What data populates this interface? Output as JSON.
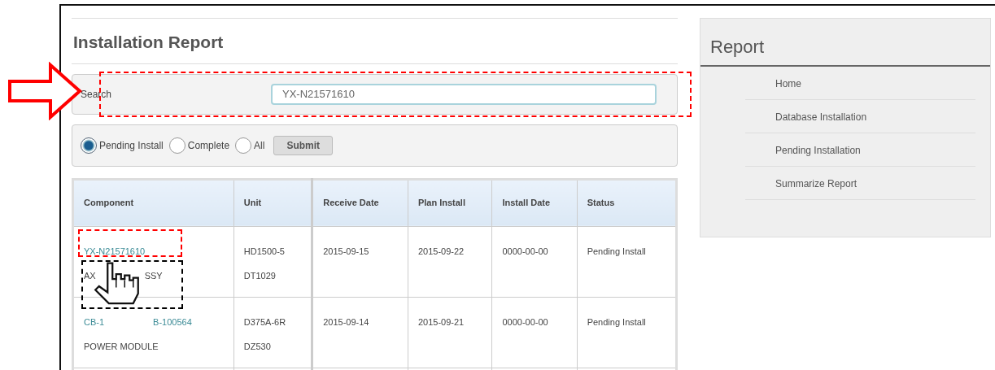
{
  "page": {
    "title": "Installation Report"
  },
  "search": {
    "label": "Search",
    "value": "YX-N21571610"
  },
  "filter": {
    "options": [
      {
        "label": "Pending Install",
        "selected": true
      },
      {
        "label": "Complete",
        "selected": false
      },
      {
        "label": "All",
        "selected": false
      }
    ],
    "submit": "Submit"
  },
  "table": {
    "columns": [
      "Component",
      "Unit",
      "Receive Date",
      "Plan Install",
      "Install Date",
      "Status"
    ],
    "rows": [
      {
        "component": [
          [
            "YX-N21571610"
          ],
          [
            "AX",
            "SSY"
          ]
        ],
        "unit": [
          "HD1500-5",
          "DT1029"
        ],
        "receive_date": "2015-09-15",
        "plan_install": "2015-09-22",
        "install_date": "0000-00-00",
        "status": "Pending Install"
      },
      {
        "component": [
          [
            "CB-1",
            "B-100564"
          ],
          [
            "POWER MODULE"
          ]
        ],
        "unit": [
          "D375A-6R",
          "DZ530"
        ],
        "receive_date": "2015-09-14",
        "plan_install": "2015-09-21",
        "install_date": "0000-00-00",
        "status": "Pending Install"
      }
    ]
  },
  "sidebar": {
    "title": "Report",
    "items": [
      "Home",
      "Database Installation",
      "Pending Installation",
      "Summarize Report"
    ]
  },
  "annotations": [
    {
      "kind": "arrow"
    },
    {
      "kind": "dashed-box",
      "color": "#ff0000"
    },
    {
      "kind": "dashed-box",
      "color": "#ff0000"
    },
    {
      "kind": "dashed-box",
      "color": "#000000"
    },
    {
      "kind": "hand-cursor"
    }
  ]
}
